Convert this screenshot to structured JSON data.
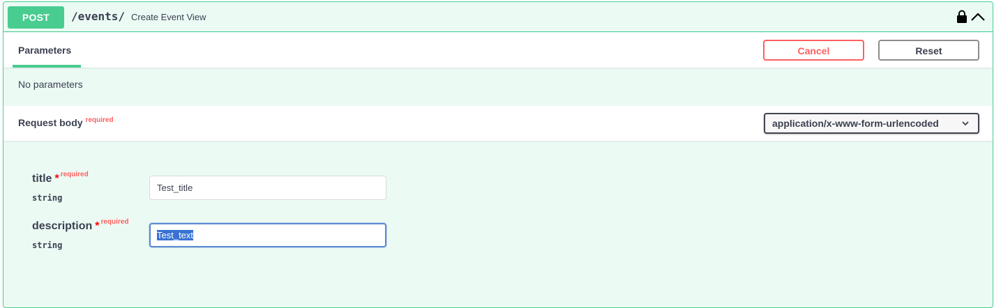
{
  "operation": {
    "method": "POST",
    "path": "/events/",
    "summary": "Create Event View"
  },
  "parameters": {
    "tab_label": "Parameters",
    "cancel_label": "Cancel",
    "reset_label": "Reset",
    "empty_text": "No parameters"
  },
  "request_body": {
    "title": "Request body",
    "required_label": "required",
    "content_type": "application/x-www-form-urlencoded",
    "fields": [
      {
        "name": "title",
        "required_star": "*",
        "required_label": "required",
        "type": "string",
        "value": "Test_title"
      },
      {
        "name": "description",
        "required_star": "*",
        "required_label": "required",
        "type": "string",
        "value": "Test_text"
      }
    ]
  },
  "colors": {
    "post_green": "#49cc90",
    "cancel_red": "#ff6060",
    "focus_blue": "#5b8ad1",
    "selection_blue": "#3871d3"
  },
  "icons": {
    "lock": "lock-icon",
    "collapse": "chevron-up-icon",
    "select": "chevron-down-icon"
  }
}
